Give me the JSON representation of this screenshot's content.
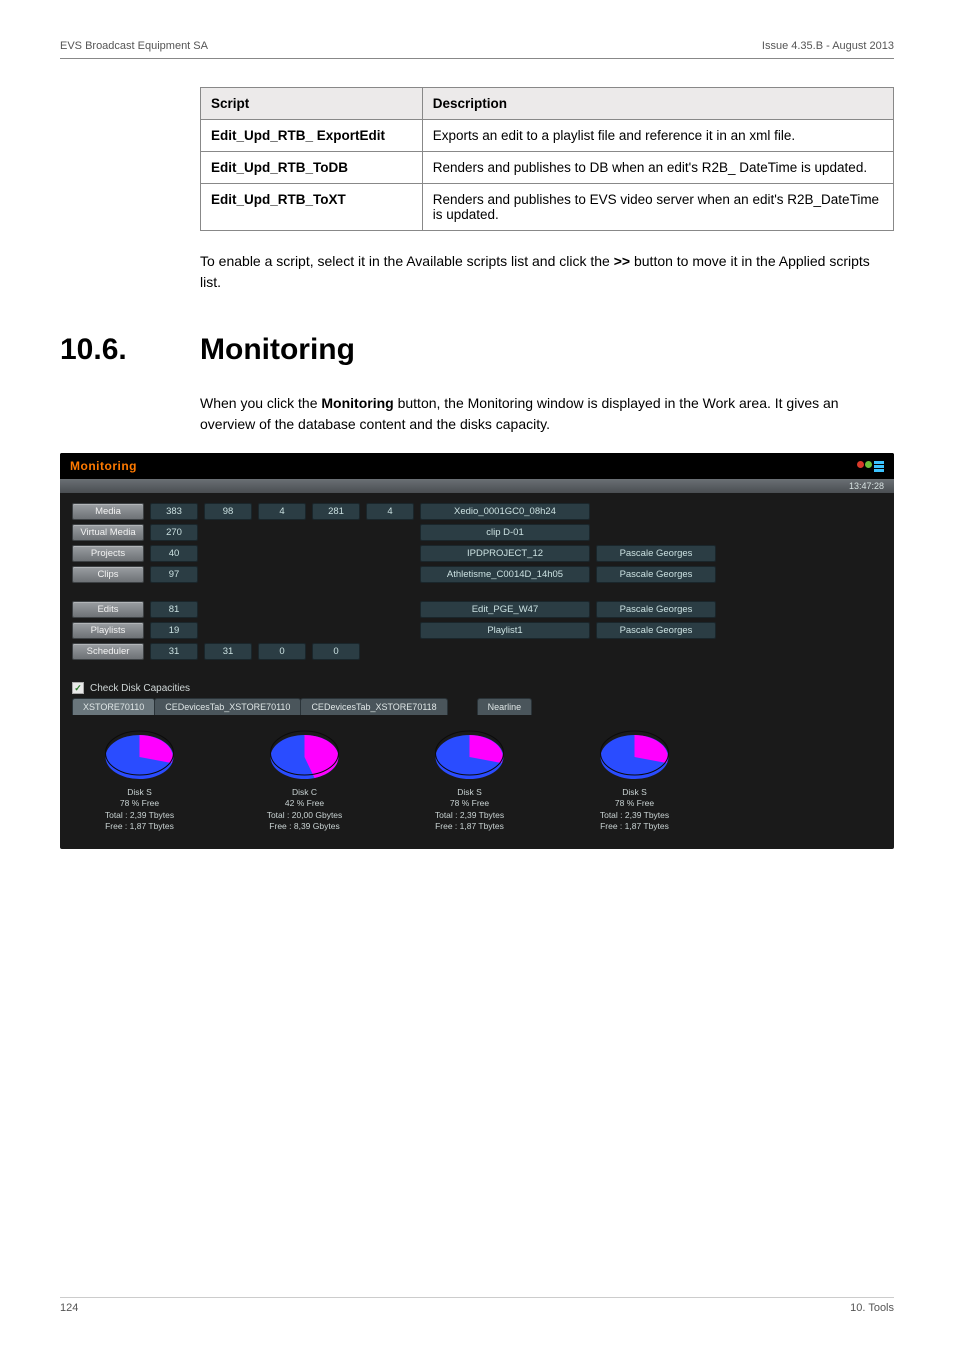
{
  "header": {
    "left": "EVS Broadcast Equipment SA",
    "right": "Issue 4.35.B - August 2013"
  },
  "table": {
    "headers": [
      "Script",
      "Description"
    ],
    "rows": [
      {
        "script": "Edit_Upd_RTB_ ExportEdit",
        "desc": "Exports an edit to a playlist file and reference it in an xml file."
      },
      {
        "script": "Edit_Upd_RTB_ToDB",
        "desc": "Renders and publishes to DB when an edit's R2B_ DateTime is updated."
      },
      {
        "script": "Edit_Upd_RTB_ToXT",
        "desc": "Renders and publishes to EVS video server when an edit's R2B_DateTime is updated."
      }
    ]
  },
  "para1_a": "To enable a script, select it in the Available scripts list and click the ",
  "para1_bold": ">>",
  "para1_b": " button to move it in the Applied scripts list.",
  "section": {
    "num": "10.6.",
    "title": "Monitoring"
  },
  "para2_a": "When you click the ",
  "para2_bold": "Monitoring",
  "para2_b": " button, the Monitoring window is displayed in the Work area. It gives an overview of the database content and the disks capacity.",
  "monitor": {
    "title": "Monitoring",
    "clock": "13:47:28",
    "rows": {
      "media": {
        "label": "Media",
        "vals": [
          "383",
          "98",
          "4",
          "281",
          "4"
        ],
        "name": "Xedio_0001GC0_08h24",
        "user": ""
      },
      "vmedia": {
        "label": "Virtual Media",
        "vals": [
          "270"
        ],
        "name": "clip D-01",
        "user": ""
      },
      "projects": {
        "label": "Projects",
        "vals": [
          "40"
        ],
        "name": "IPDPROJECT_12",
        "user": "Pascale Georges"
      },
      "clips": {
        "label": "Clips",
        "vals": [
          "97"
        ],
        "name": "Athletisme_C0014D_14h05",
        "user": "Pascale Georges"
      },
      "edits": {
        "label": "Edits",
        "vals": [
          "81"
        ],
        "name": "Edit_PGE_W47",
        "user": "Pascale Georges"
      },
      "playlists": {
        "label": "Playlists",
        "vals": [
          "19"
        ],
        "name": "Playlist1",
        "user": "Pascale Georges"
      },
      "scheduler": {
        "label": "Scheduler",
        "vals": [
          "31",
          "31",
          "0",
          "0"
        ],
        "name": "",
        "user": ""
      }
    },
    "check_label": "Check Disk Capacities",
    "tabs": [
      "XSTORE70110",
      "CEDevicesTab_XSTORE70110",
      "CEDevicesTab_XSTORE70118",
      "Nearline"
    ],
    "disks": [
      {
        "title": "Disk S",
        "free_pct": "78 % Free",
        "total": "Total : 2,39 Tbytes",
        "free": "Free : 1,87 Tbytes"
      },
      {
        "title": "Disk C",
        "free_pct": "42 % Free",
        "total": "Total : 20,00 Gbytes",
        "free": "Free : 8,39 Gbytes"
      },
      {
        "title": "Disk S",
        "free_pct": "78 % Free",
        "total": "Total : 2,39 Tbytes",
        "free": "Free : 1,87 Tbytes"
      },
      {
        "title": "Disk S",
        "free_pct": "78 % Free",
        "total": "Total : 2,39 Tbytes",
        "free": "Free : 1,87 Tbytes"
      }
    ]
  },
  "footer": {
    "left": "124",
    "right": "10. Tools"
  },
  "chart_data": [
    {
      "type": "pie",
      "title": "Disk S",
      "series": [
        {
          "name": "Used",
          "value": 22
        },
        {
          "name": "Free",
          "value": 78
        }
      ]
    },
    {
      "type": "pie",
      "title": "Disk C",
      "series": [
        {
          "name": "Used",
          "value": 58
        },
        {
          "name": "Free",
          "value": 42
        }
      ]
    },
    {
      "type": "pie",
      "title": "Disk S",
      "series": [
        {
          "name": "Used",
          "value": 22
        },
        {
          "name": "Free",
          "value": 78
        }
      ]
    },
    {
      "type": "pie",
      "title": "Disk S",
      "series": [
        {
          "name": "Used",
          "value": 22
        },
        {
          "name": "Free",
          "value": 78
        }
      ]
    }
  ]
}
